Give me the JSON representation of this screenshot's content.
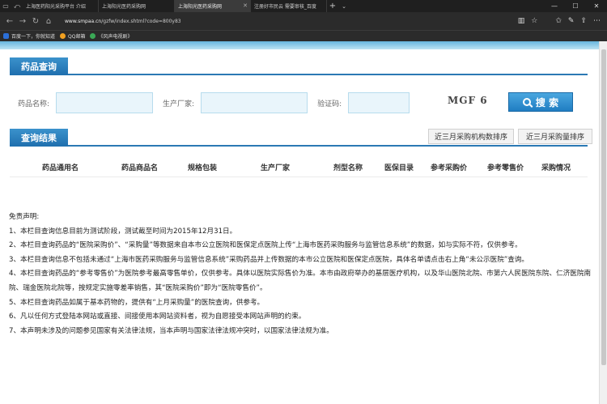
{
  "browser": {
    "tabs": [
      {
        "label": "上海医药阳光采购平台 介绍",
        "active": false
      },
      {
        "label": "上海阳光医药采购网",
        "active": false
      },
      {
        "label": "上海阳光医药采购网",
        "active": true
      },
      {
        "label": "注册好市民云 需要审核_百度",
        "active": false
      }
    ],
    "url_host": "www.smpaa.cn",
    "url_path": "/gzfw/index.shtml?code=800y83",
    "favorites": [
      {
        "label": "百度一下，你就知道",
        "color": "#2b6fd8"
      },
      {
        "label": "QQ邮箱",
        "color": "#f0a020"
      },
      {
        "label": "《风声电视剧》",
        "color": "#3aa856"
      }
    ]
  },
  "drug_query": {
    "title": "药品查询",
    "name_label": "药品名称:",
    "manufacturer_label": "生产厂家:",
    "captcha_label": "验证码:",
    "captcha_text": "MGF 6",
    "search_label": "搜 索"
  },
  "results": {
    "title": "查询结果",
    "sort_by_institutions": "近三月采购机构数排序",
    "sort_by_volume": "近三月采购量排序",
    "columns": [
      "药品通用名",
      "药品商品名",
      "规格包装",
      "生产厂家",
      "剂型名称",
      "医保目录",
      "参考采购价",
      "参考零售价",
      "采购情况"
    ]
  },
  "disclaimer": {
    "heading": "免责声明:",
    "items": [
      "1、本栏目查询信息目前为测试阶段，测试截至时间为2015年12月31日。",
      "2、本栏目查询药品的“医院采购价”、“采购量”等数据来自本市公立医院和医保定点医院上传“上海市医药采购服务与监管信息系统”的数据，如与实际不符，仅供参考。",
      "3、本栏目查询信息不包括未通过“上海市医药采购服务与监管信息系统”采购药品并上传数据的本市公立医院和医保定点医院，具体名单请点击右上角“未公示医院”查询。",
      "4、本栏目查询药品的“参考零售价”为医院参考最高零售单价，仅供参考。具体以医院实际售价为准。本市由政府举办的基层医疗机构，以及华山医院北院、市第六人民医院东院、仁济医院南院、瑞金医院北院等，按规定实施零差率销售，其“医院采购价”即为“医院零售价”。",
      "5、本栏目查询药品如属于基本药物的，提供有“上月采购量”的医院查询，供参考。",
      "6、凡以任何方式登陆本网站或直接、间接使用本网站资料者，视为自愿接受本网站声明的约束。",
      "7、本声明未涉及的问题参见国家有关法律法规，当本声明与国家法律法规冲突时，以国家法律法规为准。"
    ]
  }
}
